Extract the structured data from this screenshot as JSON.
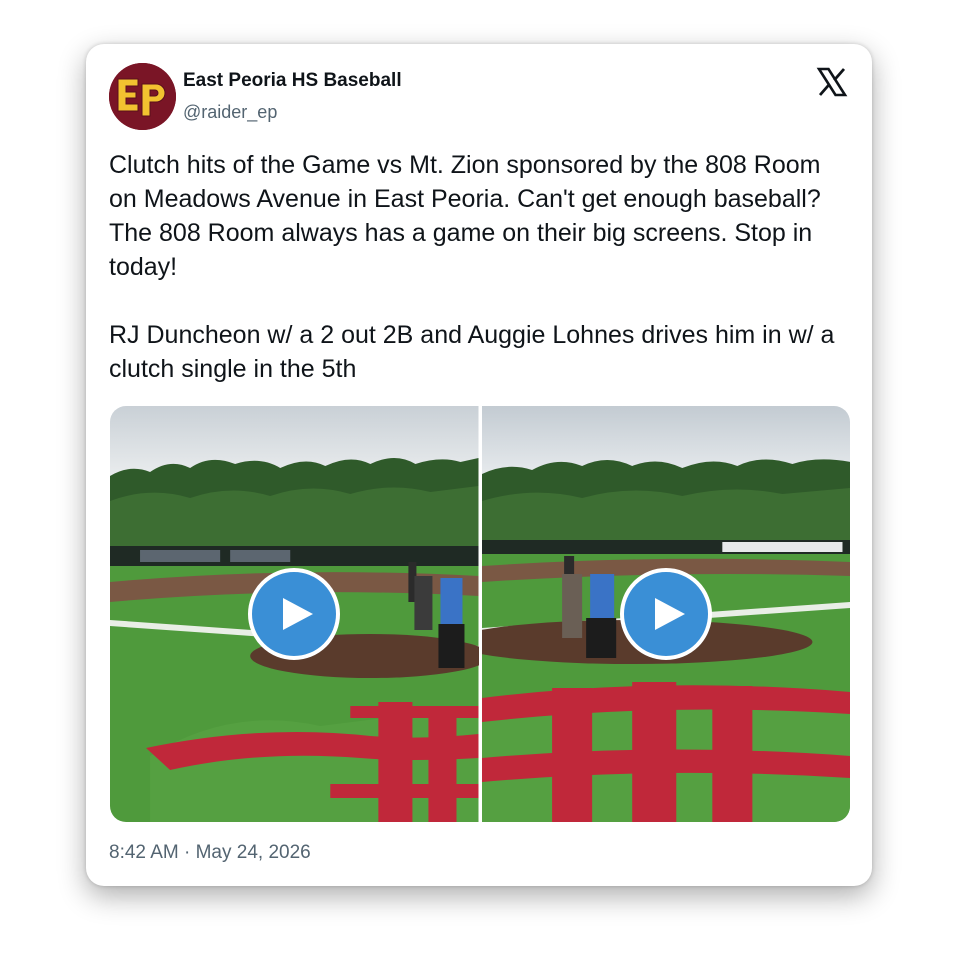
{
  "author": {
    "display_name": "East Peoria HS Baseball",
    "handle": "@raider_ep",
    "avatar_text": "EP",
    "avatar_bg": "#7a1526",
    "avatar_fg": "#f2c230"
  },
  "platform": {
    "logo_icon": "x-logo-icon"
  },
  "post": {
    "paragraph_1": "Clutch hits of the Game vs Mt. Zion sponsored by the 808 Room on Meadows Avenue in East Peoria. Can't get enough baseball?  The 808 Room always has a game on their big screens. Stop in today!",
    "paragraph_2": "RJ Duncheon w/ a 2 out 2B and Auggie Lohnes drives him in w/ a clutch single in the 5th"
  },
  "media": {
    "videos": [
      {
        "icon": "play-icon",
        "description": "batter at home plate"
      },
      {
        "icon": "play-icon",
        "description": "batter at home plate"
      }
    ],
    "accent": "#3a8fd6"
  },
  "timestamp": {
    "time": "8:42 AM",
    "separator": "·",
    "date": "May 24, 2026"
  }
}
